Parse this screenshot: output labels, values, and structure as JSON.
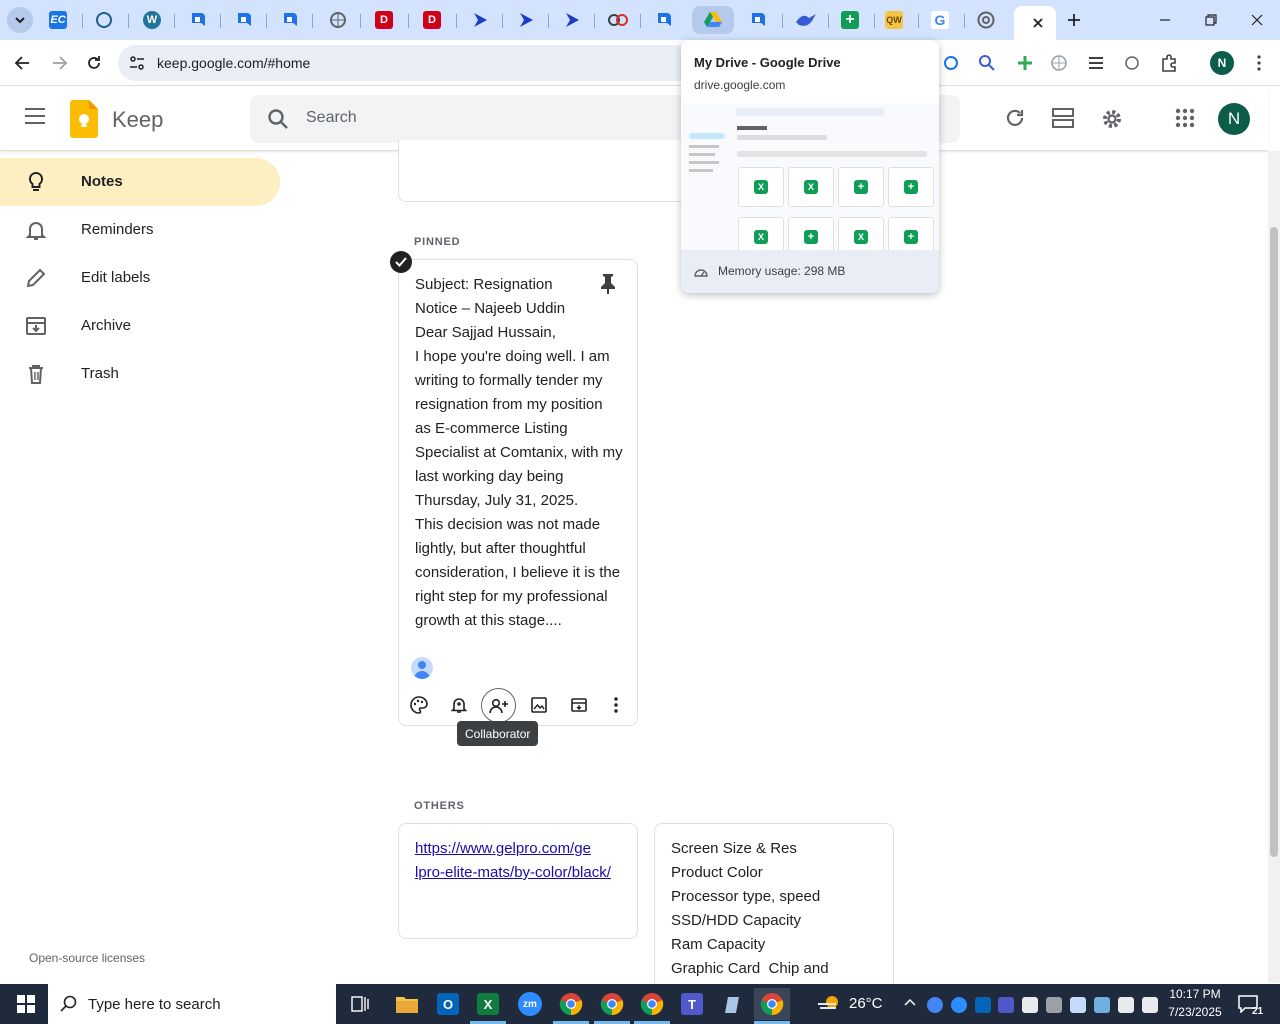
{
  "browser": {
    "tabs": [
      {
        "icon": "chevron-down-icon",
        "color": "#1f1f1f"
      },
      {
        "icon": "ec-icon",
        "color": "#1a73e8",
        "text": "EC"
      },
      {
        "icon": "c-icon",
        "color": "#1e5d8c",
        "text": "C"
      },
      {
        "icon": "wordpress-icon",
        "color": "#21759b",
        "text": "W"
      },
      {
        "icon": "chat-bubble-icon",
        "color": "#1a73e8"
      },
      {
        "icon": "chat-bubble-icon",
        "color": "#1a73e8"
      },
      {
        "icon": "chat-bubble-icon",
        "color": "#1a73e8"
      },
      {
        "icon": "globe-icon",
        "color": "#5f6368"
      },
      {
        "icon": "daraz-icon",
        "color": "#d0021b",
        "text": "D"
      },
      {
        "icon": "daraz-icon",
        "color": "#d0021b",
        "text": "D"
      },
      {
        "icon": "arrow-icon",
        "color": "#1a3fc4"
      },
      {
        "icon": "arrow-icon",
        "color": "#1a3fc4"
      },
      {
        "icon": "arrow-icon",
        "color": "#1a3fc4"
      },
      {
        "icon": "collab-icon",
        "color": "#3c4043"
      },
      {
        "icon": "chat-bubble-icon",
        "color": "#1a73e8"
      },
      {
        "icon": "drive-icon",
        "color": "#0f9d58"
      },
      {
        "icon": "chat-bubble-icon",
        "color": "#1a73e8"
      },
      {
        "icon": "bird-icon",
        "color": "#3b5bd6"
      },
      {
        "icon": "sheets-plus-icon",
        "color": "#0f9d58"
      },
      {
        "icon": "qw-icon",
        "color": "#b8860b",
        "text": "QW"
      },
      {
        "icon": "google-icon",
        "color": "#4285f4",
        "text": "G"
      },
      {
        "icon": "chrome-icon",
        "color": "#5f6368"
      },
      {
        "icon": "close-icon",
        "color": "#202124"
      }
    ],
    "url": "keep.google.com/#home"
  },
  "tab_preview": {
    "title": "My Drive - Google Drive",
    "domain": "drive.google.com",
    "memory": "Memory usage: 298 MB"
  },
  "keep": {
    "app_name": "Keep",
    "search_placeholder": "Search",
    "avatar_letter": "N",
    "nav": [
      {
        "label": "Notes",
        "icon": "lightbulb-icon"
      },
      {
        "label": "Reminders",
        "icon": "bell-icon"
      },
      {
        "label": "Edit labels",
        "icon": "pencil-icon"
      },
      {
        "label": "Archive",
        "icon": "archive-icon"
      },
      {
        "label": "Trash",
        "icon": "trash-icon"
      }
    ],
    "pinned_label": "PINNED",
    "others_label": "OTHERS",
    "pinned_note": {
      "text": "Subject: Resignation\nNotice – Najeeb Uddin\nDear Sajjad Hussain,\nI hope you're doing well. I am\nwriting to formally tender my\nresignation from my position\nas E-commerce Listing\nSpecialist at Comtanix, with my\nlast working day being\nThursday, July 31, 2025.\nThis decision was not made\nlightly, but after thoughtful\nconsideration, I believe it is the\nright step for my professional\ngrowth at this stage...."
    },
    "tooltip": "Collaborator",
    "other_notes": [
      {
        "text": "https://www.gelpro.com/ge\nlpro-elite-mats/by-color/black/"
      },
      {
        "text": "Screen Size & Res\nProduct Color\nProcessor type, speed\nSSD/HDD Capacity\nRam Capacity\nGraphic Card  Chip and"
      }
    ],
    "footer_link": "Open-source licenses"
  },
  "taskbar": {
    "search_placeholder": "Type here to search",
    "weather": "26°C",
    "time": "10:17 PM",
    "date": "7/23/2025",
    "notification_count": "21"
  }
}
